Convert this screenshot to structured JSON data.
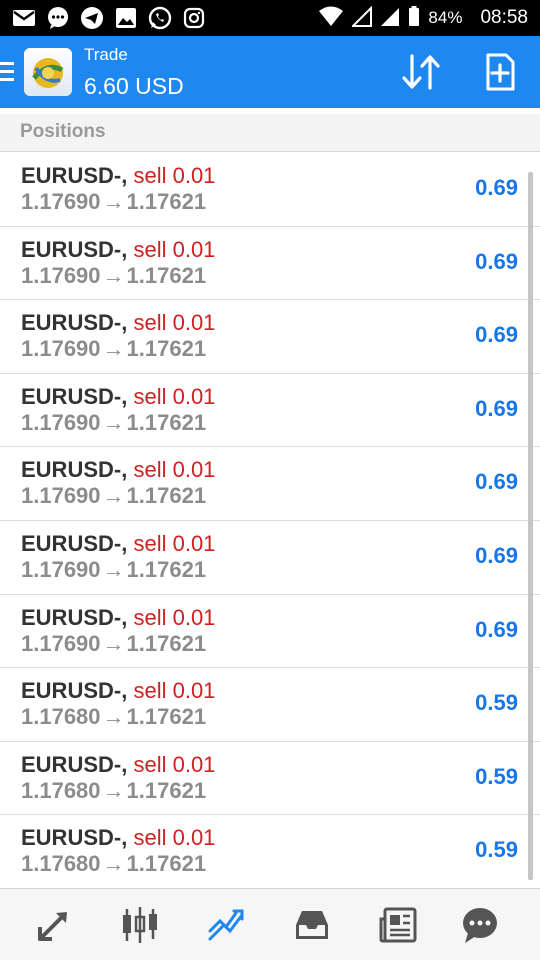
{
  "status_bar": {
    "battery_percent": "84%",
    "time": "08:58",
    "icons": [
      "gmail-icon",
      "chat-icon",
      "telegram-icon",
      "gallery-icon",
      "whatsapp-icon",
      "instagram-icon",
      "wifi-icon",
      "signal-icon",
      "signal-icon",
      "battery-icon"
    ]
  },
  "toolbar": {
    "title": "Trade",
    "balance": "6.60 USD",
    "accent_color": "#1e88f0"
  },
  "section": {
    "title": "Positions"
  },
  "positions": [
    {
      "symbol": "EURUSD-,",
      "side": "sell 0.01",
      "open_price": "1.17690",
      "arrow": "→",
      "current_price": "1.17621",
      "profit": "0.69"
    },
    {
      "symbol": "EURUSD-,",
      "side": "sell 0.01",
      "open_price": "1.17690",
      "arrow": "→",
      "current_price": "1.17621",
      "profit": "0.69"
    },
    {
      "symbol": "EURUSD-,",
      "side": "sell 0.01",
      "open_price": "1.17690",
      "arrow": "→",
      "current_price": "1.17621",
      "profit": "0.69"
    },
    {
      "symbol": "EURUSD-,",
      "side": "sell 0.01",
      "open_price": "1.17690",
      "arrow": "→",
      "current_price": "1.17621",
      "profit": "0.69"
    },
    {
      "symbol": "EURUSD-,",
      "side": "sell 0.01",
      "open_price": "1.17690",
      "arrow": "→",
      "current_price": "1.17621",
      "profit": "0.69"
    },
    {
      "symbol": "EURUSD-,",
      "side": "sell 0.01",
      "open_price": "1.17690",
      "arrow": "→",
      "current_price": "1.17621",
      "profit": "0.69"
    },
    {
      "symbol": "EURUSD-,",
      "side": "sell 0.01",
      "open_price": "1.17690",
      "arrow": "→",
      "current_price": "1.17621",
      "profit": "0.69"
    },
    {
      "symbol": "EURUSD-,",
      "side": "sell 0.01",
      "open_price": "1.17680",
      "arrow": "→",
      "current_price": "1.17621",
      "profit": "0.59"
    },
    {
      "symbol": "EURUSD-,",
      "side": "sell 0.01",
      "open_price": "1.17680",
      "arrow": "→",
      "current_price": "1.17621",
      "profit": "0.59"
    },
    {
      "symbol": "EURUSD-,",
      "side": "sell 0.01",
      "open_price": "1.17680",
      "arrow": "→",
      "current_price": "1.17621",
      "profit": "0.59"
    }
  ],
  "bottom_nav": {
    "items": [
      "quotes-icon",
      "chart-icon",
      "trade-icon",
      "history-icon",
      "news-icon",
      "chat-icon"
    ],
    "active": "trade-icon"
  }
}
